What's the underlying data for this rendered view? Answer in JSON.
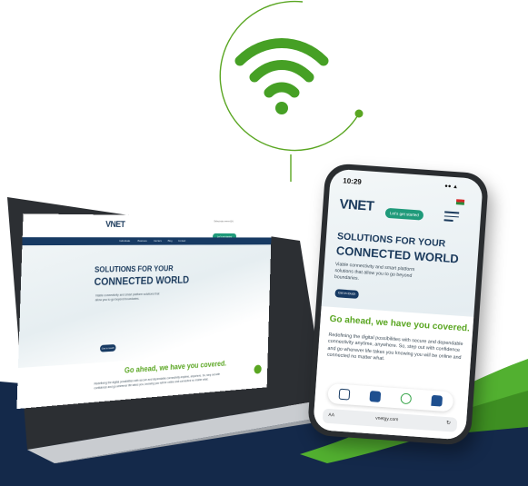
{
  "colors": {
    "brand_navy": "#173a63",
    "brand_green": "#5aa622",
    "wifi_green": "#46a025",
    "cta_teal": "#1f9a7a",
    "footer_dark": "#14294a"
  },
  "icons": [
    "wifi-icon",
    "instagram-icon",
    "facebook-icon",
    "whatsapp-icon",
    "chat-icon",
    "reload-icon",
    "hamburger-menu-icon"
  ],
  "laptop_site": {
    "logo": "VNET",
    "topinfo": "Select site: ● ● ● EN",
    "cta": "Let's get started",
    "nav": [
      "Individuals",
      "Business",
      "Carriers",
      "Blog",
      "Contact"
    ],
    "hero_line1": "SOLUTIONS FOR YOUR",
    "hero_line2": "CONNECTED WORLD",
    "hero_text": "Viable connectivity and smart platform solutions that allow you to go beyond boundaries.",
    "hero_button": "Get in touch",
    "section_title": "Go ahead, we have you covered.",
    "section_text": "Redefining the digital possibilities with secure and dependable connectivity anytime, anywhere. So, step out with confidence and go wherever life takes you, knowing you will be online and connected no matter what."
  },
  "phone_site": {
    "time": "10:29",
    "logo": "VNET",
    "cta": "Let's get started",
    "hero_line1": "SOLUTIONS FOR YOUR",
    "hero_line2": "CONNECTED WORLD",
    "hero_text": "Viable connectivity and smart platform solutions that allow you to go beyond boundaries.",
    "hero_button": "Get in touch",
    "section_title": "Go ahead, we have you covered.",
    "section_text": "Redefining the digital possibilities with secure and dependable connectivity anytime, anywhere. So, step out with confidence and go wherever life takes you knowing you will be online and connected no matter what.",
    "url_aa": "AA",
    "url": "vnetgy.com"
  }
}
